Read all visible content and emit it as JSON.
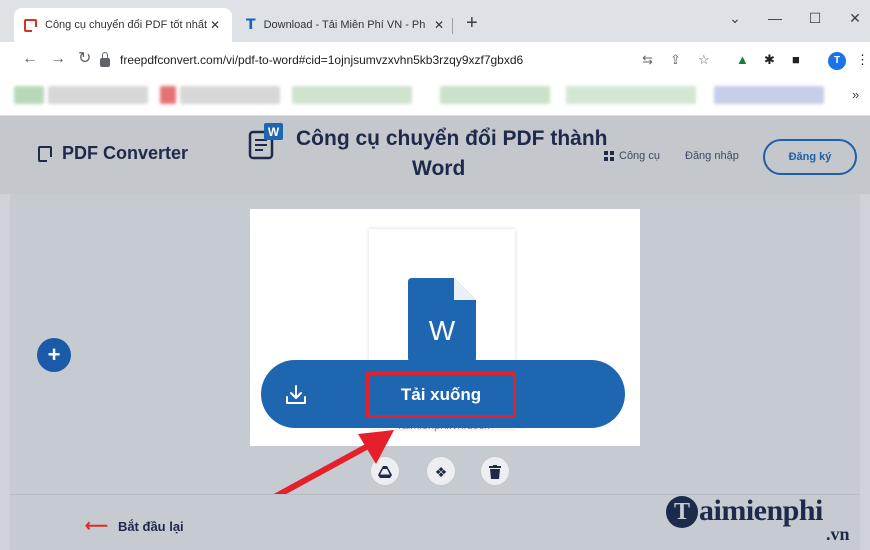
{
  "browser": {
    "tabs": [
      {
        "label": "Công cụ chuyển đổi PDF tốt nhất",
        "active": true,
        "favicon": "pdf-converter-icon"
      },
      {
        "label": "Download - Tải Miễn Phí VN - Ph",
        "active": false,
        "favicon": "taimienphi-t-icon"
      }
    ],
    "new_tab_label": "+",
    "tab_close_glyph": "✕",
    "url": "freepdfconvert.com/vi/pdf-to-word#cid=1ojnjsumvzxvhn5kb3rzqy9xzf7gbxd6",
    "profile_initial": "T",
    "bookmarks_overflow": "»"
  },
  "site": {
    "logo_text": "PDF Converter",
    "title_line1": "Công cụ chuyển đổi PDF thành",
    "title_line2": "Word",
    "nav_tools": "Công cụ",
    "nav_login": "Đăng nhập",
    "nav_signup": "Đăng ký"
  },
  "workspace": {
    "add_glyph": "+",
    "file_icon_letter": "W",
    "file_name": "Taimienphi.vn.docx",
    "download_label": "Tải xuống",
    "share_buttons": [
      "google-drive-icon",
      "dropbox-icon",
      "trash-icon"
    ]
  },
  "footer": {
    "restart_label": "Bắt đầu lại",
    "watermark_text": "aimienphi",
    "watermark_initial": "T",
    "watermark_suffix": ".vn"
  },
  "colors": {
    "brand_blue": "#1f66b0",
    "highlight_red": "#e5202a",
    "navy": "#1d2a4a"
  }
}
